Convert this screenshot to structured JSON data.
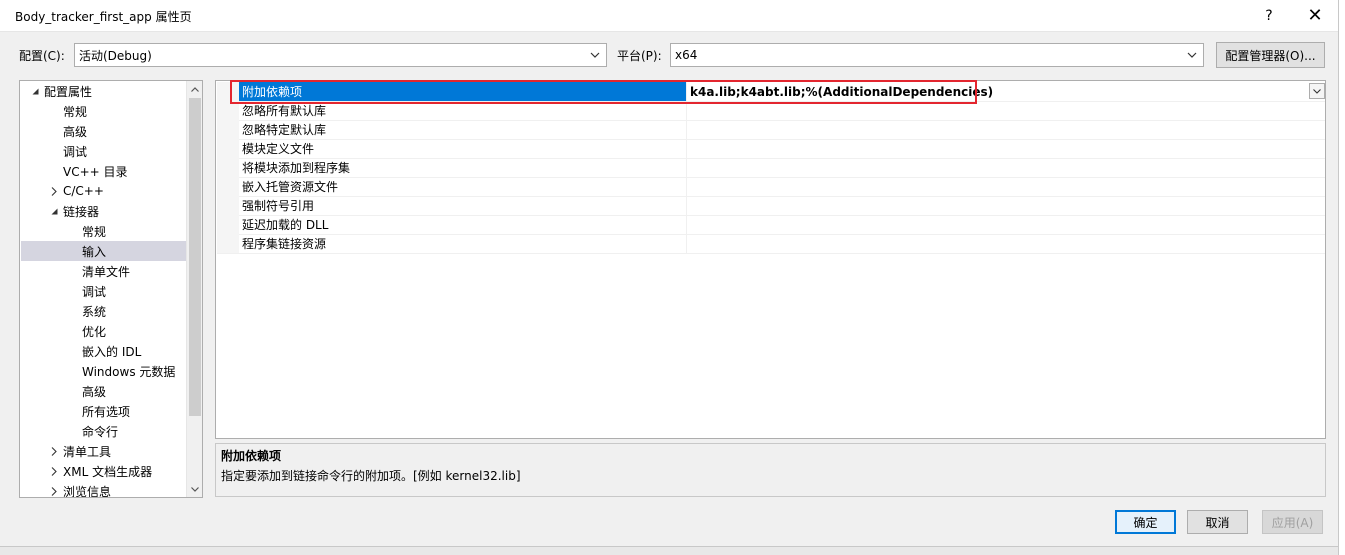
{
  "window": {
    "title": "Body_tracker_first_app 属性页",
    "help_glyph": "?",
    "close_glyph": "✕"
  },
  "config": {
    "config_label": "配置(C):",
    "config_value": "活动(Debug)",
    "platform_label": "平台(P):",
    "platform_value": "x64",
    "manager_button": "配置管理器(O)..."
  },
  "tree": {
    "items": [
      {
        "label": "配置属性",
        "level": 0,
        "arrow": "expanded"
      },
      {
        "label": "常规",
        "level": 1,
        "arrow": "none"
      },
      {
        "label": "高级",
        "level": 1,
        "arrow": "none"
      },
      {
        "label": "调试",
        "level": 1,
        "arrow": "none"
      },
      {
        "label": "VC++ 目录",
        "level": 1,
        "arrow": "none"
      },
      {
        "label": "C/C++",
        "level": 1,
        "arrow": "collapsed"
      },
      {
        "label": "链接器",
        "level": 1,
        "arrow": "expanded"
      },
      {
        "label": "常规",
        "level": 2,
        "arrow": "none"
      },
      {
        "label": "输入",
        "level": 2,
        "arrow": "none",
        "selected": true
      },
      {
        "label": "清单文件",
        "level": 2,
        "arrow": "none"
      },
      {
        "label": "调试",
        "level": 2,
        "arrow": "none"
      },
      {
        "label": "系统",
        "level": 2,
        "arrow": "none"
      },
      {
        "label": "优化",
        "level": 2,
        "arrow": "none"
      },
      {
        "label": "嵌入的 IDL",
        "level": 2,
        "arrow": "none"
      },
      {
        "label": "Windows 元数据",
        "level": 2,
        "arrow": "none"
      },
      {
        "label": "高级",
        "level": 2,
        "arrow": "none"
      },
      {
        "label": "所有选项",
        "level": 2,
        "arrow": "none"
      },
      {
        "label": "命令行",
        "level": 2,
        "arrow": "none"
      },
      {
        "label": "清单工具",
        "level": 1,
        "arrow": "collapsed"
      },
      {
        "label": "XML 文档生成器",
        "level": 1,
        "arrow": "collapsed"
      },
      {
        "label": "浏览信息",
        "level": 1,
        "arrow": "collapsed"
      }
    ]
  },
  "grid": {
    "rows": [
      {
        "name": "附加依赖项",
        "value": "k4a.lib;k4abt.lib;%(AdditionalDependencies)",
        "selected": true
      },
      {
        "name": "忽略所有默认库",
        "value": ""
      },
      {
        "name": "忽略特定默认库",
        "value": ""
      },
      {
        "name": "模块定义文件",
        "value": ""
      },
      {
        "name": "将模块添加到程序集",
        "value": ""
      },
      {
        "name": "嵌入托管资源文件",
        "value": ""
      },
      {
        "name": "强制符号引用",
        "value": ""
      },
      {
        "name": "延迟加载的 DLL",
        "value": ""
      },
      {
        "name": "程序集链接资源",
        "value": ""
      }
    ]
  },
  "description": {
    "title": "附加依赖项",
    "text": "指定要添加到链接命令行的附加项。[例如 kernel32.lib]"
  },
  "buttons": {
    "ok": "确定",
    "cancel": "取消",
    "apply": "应用(A)"
  },
  "colors": {
    "selection": "#0078d7",
    "highlight_box": "#e3262f"
  }
}
